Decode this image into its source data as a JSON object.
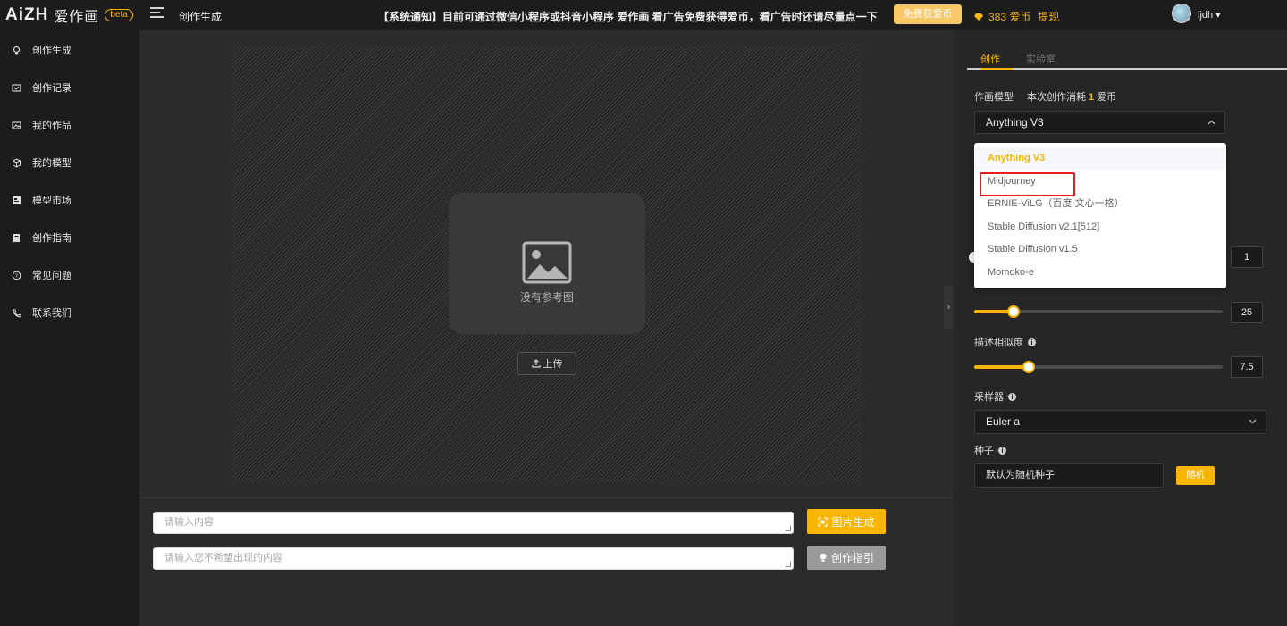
{
  "header": {
    "logo_text": "AiZH",
    "logo_cn": "爱作画",
    "beta_label": "beta",
    "page_title": "创作生成",
    "notice": "【系统通知】目前可通过微信小程序或抖音小程序 爱作画 看广告免费获得爱币，看广告时还请尽量点一下",
    "free_coins_button": "免费获爱币",
    "coins": "383 爱币",
    "topup_link": "提现",
    "username": "ljdh"
  },
  "sidebar": {
    "items": [
      {
        "label": "创作生成",
        "icon": "bulb-icon"
      },
      {
        "label": "创作记录",
        "icon": "record-icon"
      },
      {
        "label": "我的作品",
        "icon": "image-icon"
      },
      {
        "label": "我的模型",
        "icon": "cube-icon"
      },
      {
        "label": "模型市场",
        "icon": "market-icon"
      },
      {
        "label": "创作指南",
        "icon": "guide-icon"
      },
      {
        "label": "常见问题",
        "icon": "question-icon"
      },
      {
        "label": "联系我们",
        "icon": "phone-icon"
      }
    ]
  },
  "main": {
    "no_reference": "没有参考图",
    "upload_button": "上传",
    "prompt_placeholder": "请输入内容",
    "negative_placeholder": "请输入您不希望出现的内容",
    "generate_button": "图片生成",
    "guide_button": "创作指引"
  },
  "panel": {
    "tabs": [
      "创作",
      "实验室"
    ],
    "model_label": "作画模型",
    "cost_prefix": "本次创作消耗",
    "cost_value": "1",
    "cost_unit": "爱币",
    "model_selected": "Anything V3",
    "model_options": [
      "Anything V3",
      "Midjourney",
      "ERNIE-ViLG（百度 文心一格）",
      "Stable Diffusion v2.1[512]",
      "Stable Diffusion v1.5",
      "Momoko-e"
    ],
    "count_value": "1",
    "steps_value": "25",
    "steps_fraction": 0.16,
    "similarity_label": "描述相似度",
    "similarity_value": "7.5",
    "similarity_fraction": 0.22,
    "sampler_label": "采样器",
    "sampler_value": "Euler a",
    "seed_label": "种子",
    "seed_placeholder": "默认为随机种子",
    "random_button": "随机"
  },
  "colors": {
    "accent": "#f7b500",
    "highlight_frame": "#e02020"
  }
}
